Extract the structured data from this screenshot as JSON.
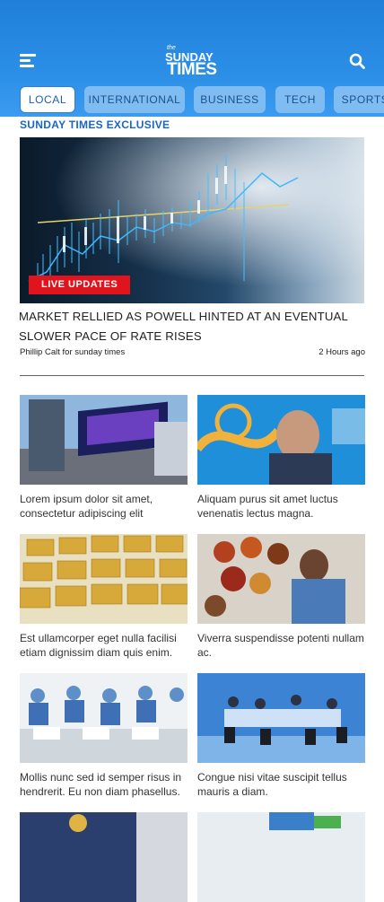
{
  "header": {
    "logo_small": "the",
    "logo_line1": "SUNDAY",
    "logo_line2": "TIMES",
    "menu_icon": "menu-icon",
    "search_icon": "search-icon"
  },
  "tabs": [
    "LOCAL",
    "INTERNATIONAL",
    "BUSINESS",
    "TECH",
    "SPORTS"
  ],
  "section_label": "SUNDAY TIMES EXCLUSIVE",
  "featured": {
    "badge": "LIVE UPDATES",
    "headline": "MARKET RELLIED AS POWELL HINTED AT AN EVENTUAL SLOWER PACE OF RATE RISES",
    "byline": "Phillip Calt for sunday times",
    "time": "2 Hours ago"
  },
  "articles": [
    {
      "caption": "Lorem ipsum dolor sit amet, consectetur adipiscing elit"
    },
    {
      "caption": "Aliquam purus sit amet luctus venenatis lectus magna."
    },
    {
      "caption": "Est ullamcorper eget nulla facilisi etiam dignissim diam quis enim."
    },
    {
      "caption": "Viverra suspendisse potenti nullam ac."
    },
    {
      "caption": "Mollis nunc sed id semper risus in hendrerit. Eu non diam phasellus."
    },
    {
      "caption": "Congue nisi vitae suscipit tellus mauris a diam."
    },
    {
      "caption": ""
    },
    {
      "caption": ""
    }
  ],
  "colors": {
    "header_blue": "#2b8ee6",
    "tab_inactive": "#7fbcf2",
    "badge_red": "#e0141c",
    "accent_text": "#1a66c0"
  }
}
